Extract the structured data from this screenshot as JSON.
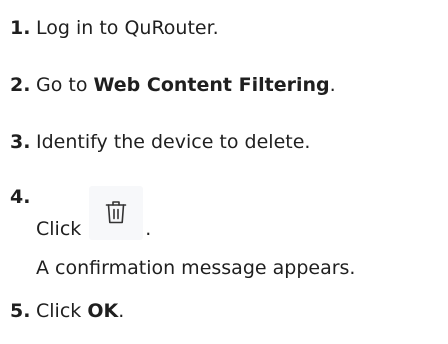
{
  "steps": [
    {
      "num": "1.",
      "pre": "Log in to QuRouter.",
      "bold": "",
      "post": ""
    },
    {
      "num": "2.",
      "pre": "Go to ",
      "bold": "Web Content Filtering",
      "post": "."
    },
    {
      "num": "3.",
      "pre": "Identify the device to delete.",
      "bold": "",
      "post": ""
    },
    {
      "num": "4.",
      "click": "Click",
      "icon": "trash-icon",
      "after_icon": ".",
      "note": "A confirmation message appears."
    },
    {
      "num": "5.",
      "pre": "Click ",
      "bold": "OK",
      "post": "."
    }
  ],
  "colors": {
    "text": "#1f1f1f",
    "icon_bg": "#f7f8fa",
    "icon_stroke": "#333333"
  }
}
